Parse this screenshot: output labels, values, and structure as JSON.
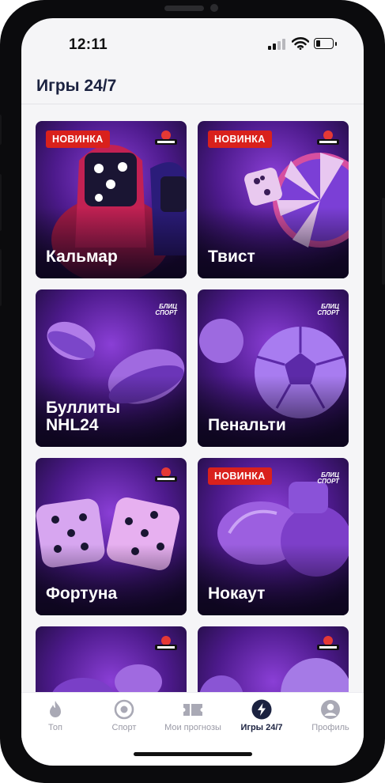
{
  "status": {
    "time": "12:11"
  },
  "page": {
    "title": "Игры 24/7"
  },
  "games": [
    {
      "title": "Кальмар",
      "badge": "НОВИНКА",
      "brand": "NARDBALL"
    },
    {
      "title": "Твист",
      "badge": "НОВИНКА",
      "brand": "NARDBALL"
    },
    {
      "title": "Буллиты\nNHL24",
      "badge": "",
      "brand": "БЛИЦ СПОРТ"
    },
    {
      "title": "Пенальти",
      "badge": "",
      "brand": "БЛИЦ СПОРТ"
    },
    {
      "title": "Фортуна",
      "badge": "",
      "brand": "NARDBALL"
    },
    {
      "title": "Нокаут",
      "badge": "НОВИНКА",
      "brand": "БЛИЦ СПОРТ"
    },
    {
      "title": "",
      "badge": "",
      "brand": "NARDBALL"
    },
    {
      "title": "",
      "badge": "",
      "brand": "NARDBALL"
    }
  ],
  "tabs": [
    {
      "label": "Топ",
      "icon": "flame-icon"
    },
    {
      "label": "Спорт",
      "icon": "target-icon"
    },
    {
      "label": "Мои прогнозы",
      "icon": "ticket-icon"
    },
    {
      "label": "Игры 24/7",
      "icon": "lightning-icon",
      "active": true
    },
    {
      "label": "Профиль",
      "icon": "user-icon"
    }
  ],
  "colors": {
    "accent": "#1b2240",
    "badge": "#d9211c",
    "inactive": "#9a9aa6"
  }
}
